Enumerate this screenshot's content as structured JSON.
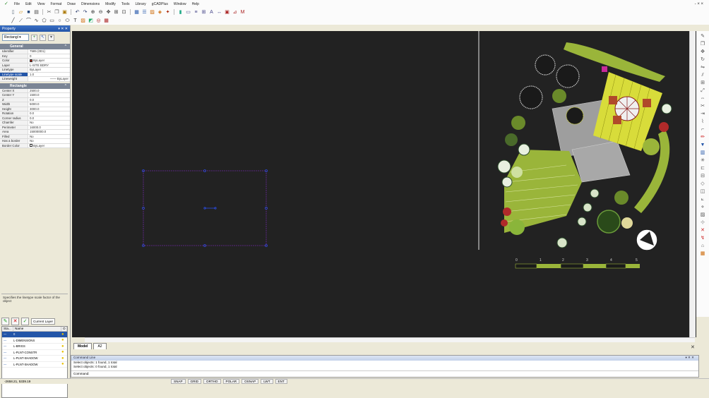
{
  "menu": {
    "items": [
      "File",
      "Edit",
      "View",
      "Format",
      "Draw",
      "Dimensions",
      "Modify",
      "Tools",
      "Library",
      "gCADPlus",
      "Window",
      "Help"
    ],
    "window_controls": "- × ×"
  },
  "properties": {
    "title": "Property",
    "title_controls": "▾ ✕ ✕",
    "object_type": "Rectangl",
    "general_header": "General",
    "general": [
      {
        "key": "Identifier",
        "value": "7585 (0D1)"
      },
      {
        "key": "Key",
        "value": "0"
      },
      {
        "key": "Color",
        "value": "ByLayer"
      },
      {
        "key": "Layer",
        "value": "L-SITE BDRY"
      },
      {
        "key": "Linetype",
        "value": "ByLayer"
      },
      {
        "key": "Linetype scale",
        "value": "1.0"
      },
      {
        "key": "Lineweight",
        "value": "—— ByLayer"
      }
    ],
    "rect_header": "Rectangle",
    "rectangle": [
      {
        "key": "Center X",
        "value": "2500.0"
      },
      {
        "key": "Center Y",
        "value": "1500.0"
      },
      {
        "key": "Z",
        "value": "0.0"
      },
      {
        "key": "Width",
        "value": "5000.0"
      },
      {
        "key": "Height",
        "value": "3000.0"
      },
      {
        "key": "Rotation",
        "value": "0.0"
      },
      {
        "key": "Corner radius",
        "value": "0.0"
      },
      {
        "key": "Chamfer",
        "value": "No"
      },
      {
        "key": "Perimeter",
        "value": "16000.0"
      },
      {
        "key": "Area",
        "value": "15000000.0"
      },
      {
        "key": "Filled",
        "value": "No"
      },
      {
        "key": "Has a border",
        "value": "No"
      },
      {
        "key": "Border Color",
        "value": "ByLayer"
      }
    ],
    "description": "Specifies the linetype scale factor of the object"
  },
  "layers": {
    "current_label": "Current Layer",
    "col_status": "Sta...",
    "col_name": "Name",
    "rows": [
      {
        "status": "—",
        "name": "0"
      },
      {
        "status": "—",
        "name": "L-DIMENSIONS"
      },
      {
        "status": "—",
        "name": "L-BRIGS"
      },
      {
        "status": "—",
        "name": "L-PLNT-CONSTR"
      },
      {
        "status": "—",
        "name": "L-PLNT-SHADOW"
      },
      {
        "status": "—",
        "name": "L-PLNT-SHADOW"
      }
    ]
  },
  "drawing": {
    "scale_labels": [
      "0",
      "1",
      "2",
      "3",
      "4",
      "5"
    ]
  },
  "tabs": [
    "Model",
    "A2"
  ],
  "command": {
    "title": "Command Line",
    "title_controls": "▾ ✕ ✕",
    "lines": [
      "Select objects: 1 found, 1 total",
      "Select objects: 0 found, 1 total"
    ],
    "prompt": "Command:"
  },
  "status": {
    "coords": "-2658.21, 5339.19",
    "buttons": [
      "SNAP",
      "GRID",
      "ORTHO",
      "POLAR",
      "OSNAP",
      "LWT",
      "ENT"
    ]
  },
  "colors": {
    "canvas": "#222222",
    "selection": "#6a2a9a",
    "grips": "#2a4adc",
    "lawn": "#9ab53a",
    "deck": "#d8dc3a",
    "paving": "#9e9e9e"
  }
}
